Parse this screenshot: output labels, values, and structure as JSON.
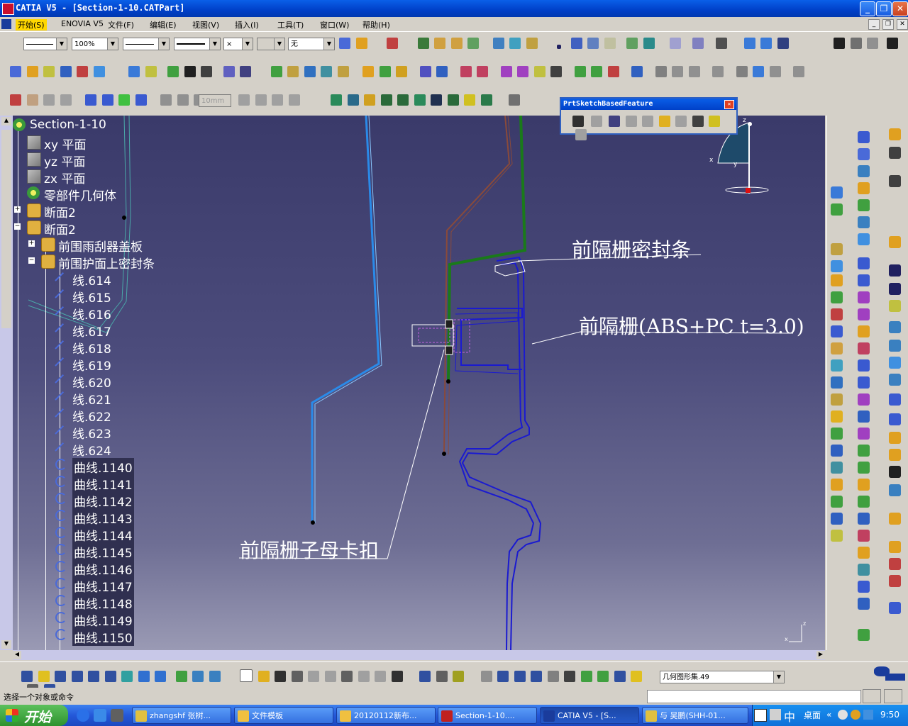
{
  "window": {
    "title": "CATIA V5 - [Section-1-10.CATPart]",
    "min": "_",
    "restore": "❐",
    "close": "✕"
  },
  "menu": {
    "items": [
      "开始(S)",
      "ENOVIA V5",
      "文件(F)",
      "编辑(E)",
      "视图(V)",
      "插入(I)",
      "工具(T)",
      "窗口(W)",
      "帮助(H)"
    ],
    "mdi_min": "_",
    "mdi_restore": "❐",
    "mdi_close": "✕"
  },
  "toolbar": {
    "zoom_combo": "100%",
    "layer_combo": "无",
    "thickness_field": "10mm",
    "x_combo": "×"
  },
  "floating_toolbar": {
    "title": "PrtSketchBasedFeature",
    "close": "✕"
  },
  "tree": {
    "root": "Section-1-10",
    "nodes": [
      {
        "label": "xy 平面",
        "icon": "plane-icon"
      },
      {
        "label": "yz 平面",
        "icon": "plane-icon"
      },
      {
        "label": "zx 平面",
        "icon": "plane-icon"
      },
      {
        "label": "零部件几何体",
        "icon": "body-icon"
      },
      {
        "label": "断面2",
        "icon": "section-icon"
      },
      {
        "label": "断面2",
        "icon": "section-icon"
      },
      {
        "label": "前围雨刮器盖板",
        "icon": "section-icon"
      },
      {
        "label": "前围护面上密封条",
        "icon": "section-icon"
      },
      {
        "label": "线.614",
        "icon": "line-icon"
      },
      {
        "label": "线.615",
        "icon": "line-icon"
      },
      {
        "label": "线.616",
        "icon": "line-icon"
      },
      {
        "label": "线.617",
        "icon": "line-icon"
      },
      {
        "label": "线.618",
        "icon": "line-icon"
      },
      {
        "label": "线.619",
        "icon": "line-icon"
      },
      {
        "label": "线.620",
        "icon": "line-icon"
      },
      {
        "label": "线.621",
        "icon": "line-icon"
      },
      {
        "label": "线.622",
        "icon": "line-icon"
      },
      {
        "label": "线.623",
        "icon": "line-icon"
      },
      {
        "label": "线.624",
        "icon": "line-icon"
      },
      {
        "label": "曲线.1140",
        "icon": "curve-icon"
      },
      {
        "label": "曲线.1141",
        "icon": "curve-icon"
      },
      {
        "label": "曲线.1142",
        "icon": "curve-icon"
      },
      {
        "label": "曲线.1143",
        "icon": "curve-icon"
      },
      {
        "label": "曲线.1144",
        "icon": "curve-icon"
      },
      {
        "label": "曲线.1145",
        "icon": "curve-icon"
      },
      {
        "label": "曲线.1146",
        "icon": "curve-icon"
      },
      {
        "label": "曲线.1147",
        "icon": "curve-icon"
      },
      {
        "label": "曲线.1148",
        "icon": "curve-icon"
      },
      {
        "label": "曲线.1149",
        "icon": "curve-icon"
      },
      {
        "label": "曲线.1150",
        "icon": "curve-icon"
      }
    ]
  },
  "annotations": {
    "seal": "前隔栅密封条",
    "grille": "前隔栅(ABS+PC  t=3.0)",
    "clip": "前隔栅子母卡扣"
  },
  "compass": {
    "x": "x",
    "y": "y",
    "z": "z"
  },
  "bottom_toolbar": {
    "geometry_set_combo": "几何图形集.49"
  },
  "status": {
    "prompt": "选择一个对象或命令"
  },
  "taskbar": {
    "start": "开始",
    "tasks": [
      {
        "label": "zhangshf 张树...",
        "icon": "chat-icon",
        "active": false
      },
      {
        "label": "文件模板",
        "icon": "folder-icon",
        "active": false
      },
      {
        "label": "20120112新布...",
        "icon": "folder-icon",
        "active": false
      },
      {
        "label": "Section-1-10....",
        "icon": "pdf-icon",
        "active": false
      },
      {
        "label": "CATIA V5 - [S...",
        "icon": "catia-icon",
        "active": true
      },
      {
        "label": "与 吴鹏(SHH-01...",
        "icon": "chat-icon",
        "active": false
      }
    ],
    "ime": "中",
    "desktop": "桌面",
    "clock": "9:50"
  },
  "colors": {
    "titlebar": "#0a5fe8",
    "viewport_top": "#3a3a6a",
    "viewport_bottom": "#9a9ab4",
    "grille": "#1a1ad0",
    "seal": "#1a7a1a",
    "panel_blue": "#2a8ae8",
    "brown": "#8a4a3a"
  }
}
